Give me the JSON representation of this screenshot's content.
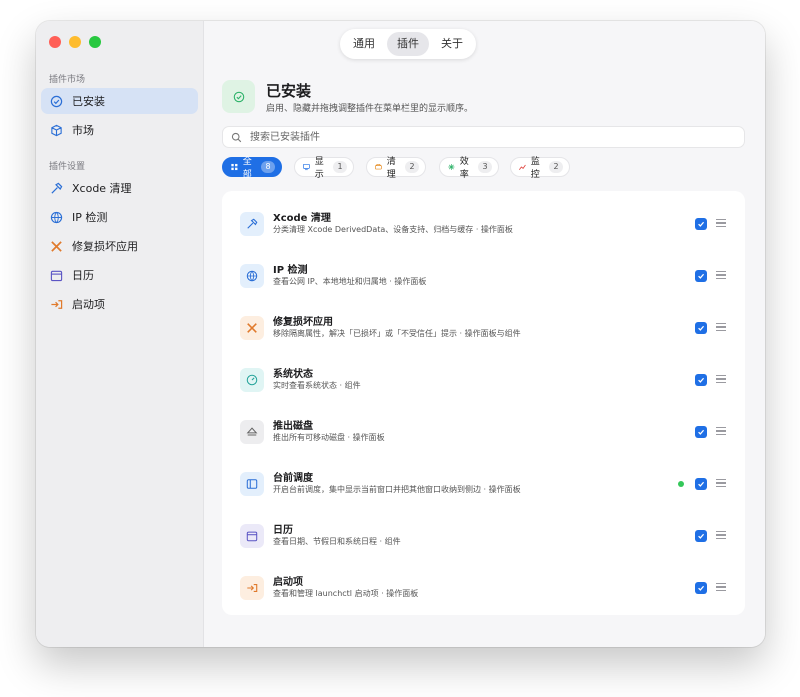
{
  "topbar": {
    "tabs": [
      {
        "label": "通用"
      },
      {
        "label": "插件"
      },
      {
        "label": "关于"
      }
    ],
    "active_tab": 1
  },
  "sidebar": {
    "section_market": "插件市场",
    "market_items": [
      {
        "label": "已安装",
        "icon": "check-circle-icon"
      },
      {
        "label": "市场",
        "icon": "cube-icon"
      }
    ],
    "section_settings": "插件设置",
    "setting_items": [
      {
        "label": "Xcode 清理",
        "icon": "hammer-icon"
      },
      {
        "label": "IP 检测",
        "icon": "globe-icon"
      },
      {
        "label": "修复损坏应用",
        "icon": "tools-icon"
      },
      {
        "label": "日历",
        "icon": "calendar-icon"
      },
      {
        "label": "启动项",
        "icon": "startup-icon"
      }
    ]
  },
  "header": {
    "title": "已安装",
    "subtitle": "启用、隐藏并拖拽调整插件在菜单栏里的显示顺序。"
  },
  "search": {
    "placeholder": "搜索已安装插件",
    "value": ""
  },
  "filters": [
    {
      "label": "全部",
      "count": "8",
      "active": true,
      "color": "#1f6fe5"
    },
    {
      "label": "显示",
      "count": "1",
      "color": "#1f6fe5"
    },
    {
      "label": "清理",
      "count": "2",
      "color": "#e58a1f"
    },
    {
      "label": "效率",
      "count": "3",
      "color": "#2fb36a"
    },
    {
      "label": "监控",
      "count": "2",
      "color": "#e0443e"
    }
  ],
  "plugins": [
    {
      "name": "Xcode 清理",
      "desc": "分类清理 Xcode DerivedData、设备支持、归档与缓存 · 操作面板",
      "icon": "hammer-icon",
      "bg": "#e3effc",
      "fg": "#2b6fd6",
      "enabled": true,
      "status_dot": false
    },
    {
      "name": "IP 检测",
      "desc": "查看公网 IP、本地地址和归属地 · 操作面板",
      "icon": "globe-icon",
      "bg": "#e3effc",
      "fg": "#2b6fd6",
      "enabled": true,
      "status_dot": false
    },
    {
      "name": "修复损坏应用",
      "desc": "移除隔离属性，解决「已损坏」或「不受信任」提示 · 操作面板与组件",
      "icon": "tools-icon",
      "bg": "#fdeee0",
      "fg": "#e07a2c",
      "enabled": true,
      "status_dot": false
    },
    {
      "name": "系统状态",
      "desc": "实时查看系统状态 · 组件",
      "icon": "gauge-icon",
      "bg": "#e0f5f4",
      "fg": "#23a39a",
      "enabled": true,
      "status_dot": false
    },
    {
      "name": "推出磁盘",
      "desc": "推出所有可移动磁盘 · 操作面板",
      "icon": "eject-icon",
      "bg": "#ededef",
      "fg": "#666666",
      "enabled": true,
      "status_dot": false
    },
    {
      "name": "台前调度",
      "desc": "开启台前调度，集中显示当前窗口并把其他窗口收纳到侧边 · 操作面板",
      "icon": "stage-icon",
      "bg": "#e3effc",
      "fg": "#2b6fd6",
      "enabled": true,
      "status_dot": true
    },
    {
      "name": "日历",
      "desc": "查看日期、节假日和系统日程 · 组件",
      "icon": "calendar-icon",
      "bg": "#ebe9f8",
      "fg": "#5b55c4",
      "enabled": true,
      "status_dot": false
    },
    {
      "name": "启动项",
      "desc": "查看和管理 launchctl 启动项 · 操作面板",
      "icon": "startup-icon",
      "bg": "#fdeee0",
      "fg": "#e07a2c",
      "enabled": true,
      "status_dot": false
    }
  ]
}
